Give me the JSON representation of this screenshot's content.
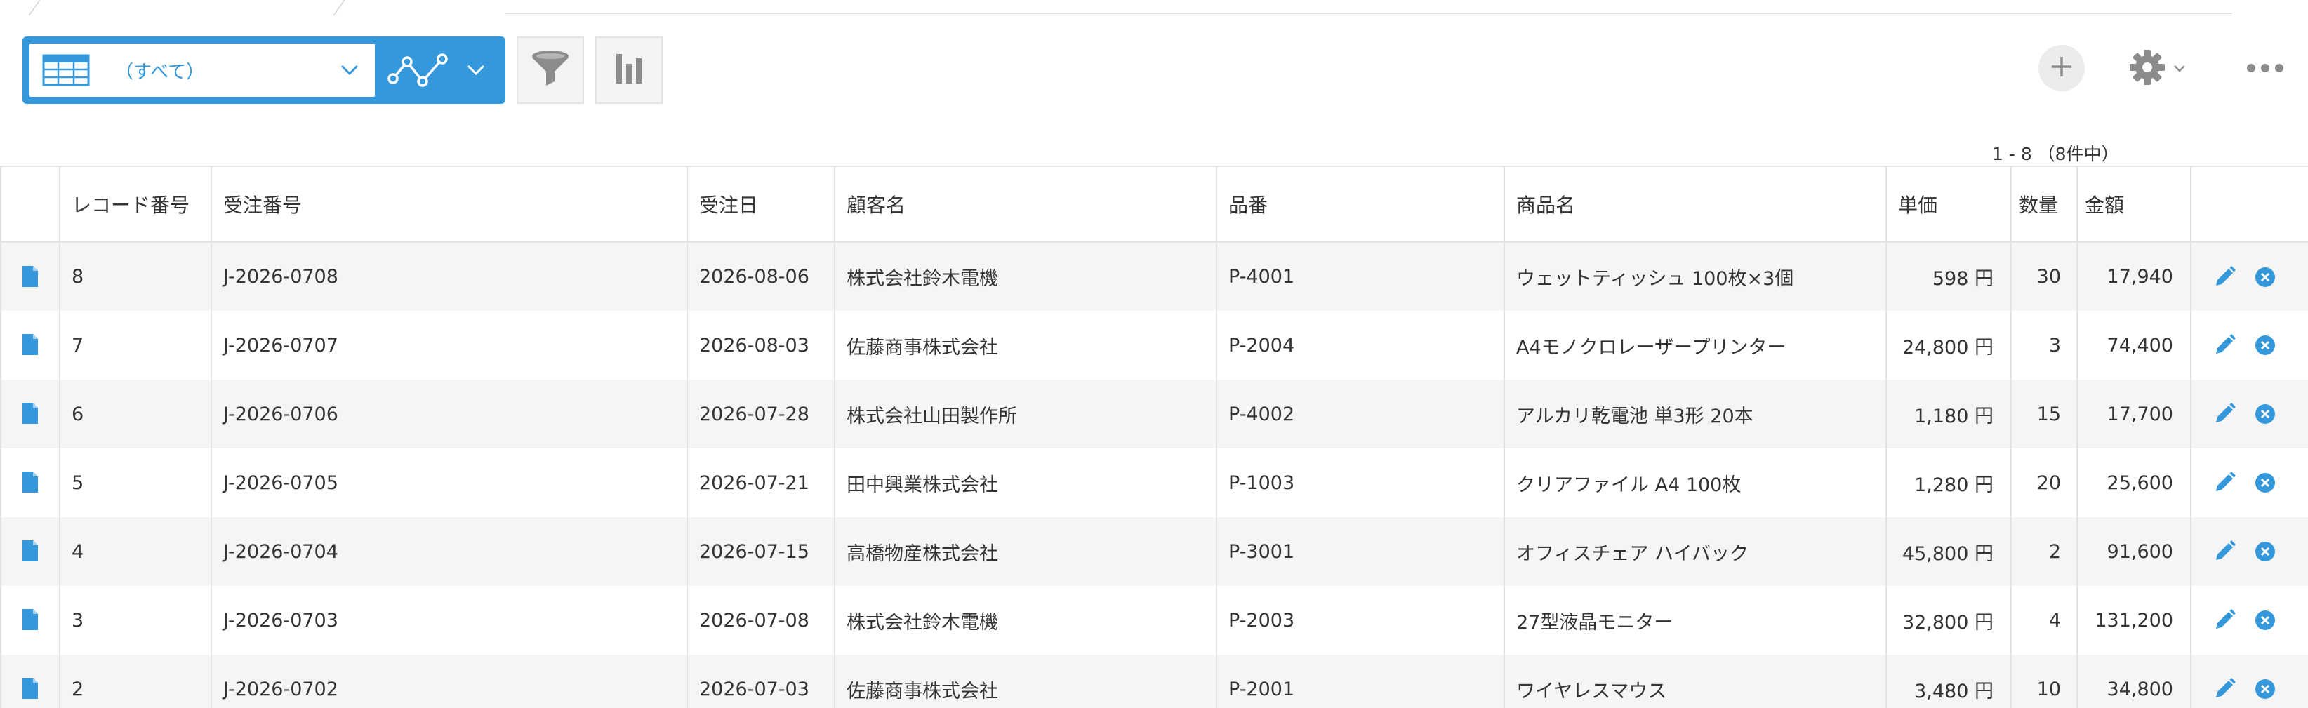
{
  "view": {
    "label": "（すべて）",
    "icons": {
      "view_type": "table-icon",
      "view_menu": "chevron-down-icon",
      "graph": "line-graph-icon",
      "graph_menu": "chevron-down-icon"
    }
  },
  "tools": {
    "filter": "funnel-icon",
    "chart": "bar-chart-icon"
  },
  "actions": {
    "add": "plus-icon",
    "settings": "gear-icon",
    "settings_menu": "chevron-down-icon",
    "more": "ellipsis-icon"
  },
  "colors": {
    "accent": "#3498db",
    "icon_gray": "#8c8c8c",
    "row_alt": "#f5f5f5",
    "border": "#e3e3e3"
  },
  "pager": {
    "text": "1 - 8 （8件中）"
  },
  "table": {
    "columns": [
      "",
      "レコード番号",
      "受注番号",
      "受注日",
      "顧客名",
      "品番",
      "商品名",
      "単価",
      "数量",
      "金額",
      ""
    ],
    "rows": [
      {
        "record_no": "8",
        "order_no": "J-2026-0708",
        "order_date": "2026-08-06",
        "customer": "株式会社鈴木電機",
        "part_no": "P-4001",
        "product": "ウェットティッシュ 100枚×3個",
        "unit_price": "598 円",
        "qty": "30",
        "amount": "17,940"
      },
      {
        "record_no": "7",
        "order_no": "J-2026-0707",
        "order_date": "2026-08-03",
        "customer": "佐藤商事株式会社",
        "part_no": "P-2004",
        "product": "A4モノクロレーザープリンター",
        "unit_price": "24,800 円",
        "qty": "3",
        "amount": "74,400"
      },
      {
        "record_no": "6",
        "order_no": "J-2026-0706",
        "order_date": "2026-07-28",
        "customer": "株式会社山田製作所",
        "part_no": "P-4002",
        "product": "アルカリ乾電池 単3形 20本",
        "unit_price": "1,180 円",
        "qty": "15",
        "amount": "17,700"
      },
      {
        "record_no": "5",
        "order_no": "J-2026-0705",
        "order_date": "2026-07-21",
        "customer": "田中興業株式会社",
        "part_no": "P-1003",
        "product": "クリアファイル A4 100枚",
        "unit_price": "1,280 円",
        "qty": "20",
        "amount": "25,600"
      },
      {
        "record_no": "4",
        "order_no": "J-2026-0704",
        "order_date": "2026-07-15",
        "customer": "高橋物産株式会社",
        "part_no": "P-3001",
        "product": "オフィスチェア ハイバック",
        "unit_price": "45,800 円",
        "qty": "2",
        "amount": "91,600"
      },
      {
        "record_no": "3",
        "order_no": "J-2026-0703",
        "order_date": "2026-07-08",
        "customer": "株式会社鈴木電機",
        "part_no": "P-2003",
        "product": "27型液晶モニター",
        "unit_price": "32,800 円",
        "qty": "4",
        "amount": "131,200"
      },
      {
        "record_no": "2",
        "order_no": "J-2026-0702",
        "order_date": "2026-07-03",
        "customer": "佐藤商事株式会社",
        "part_no": "P-2001",
        "product": "ワイヤレスマウス",
        "unit_price": "3,480 円",
        "qty": "10",
        "amount": "34,800"
      }
    ],
    "row_icons": {
      "detail": "document-icon",
      "edit": "pencil-icon",
      "delete": "close-circle-icon"
    }
  }
}
